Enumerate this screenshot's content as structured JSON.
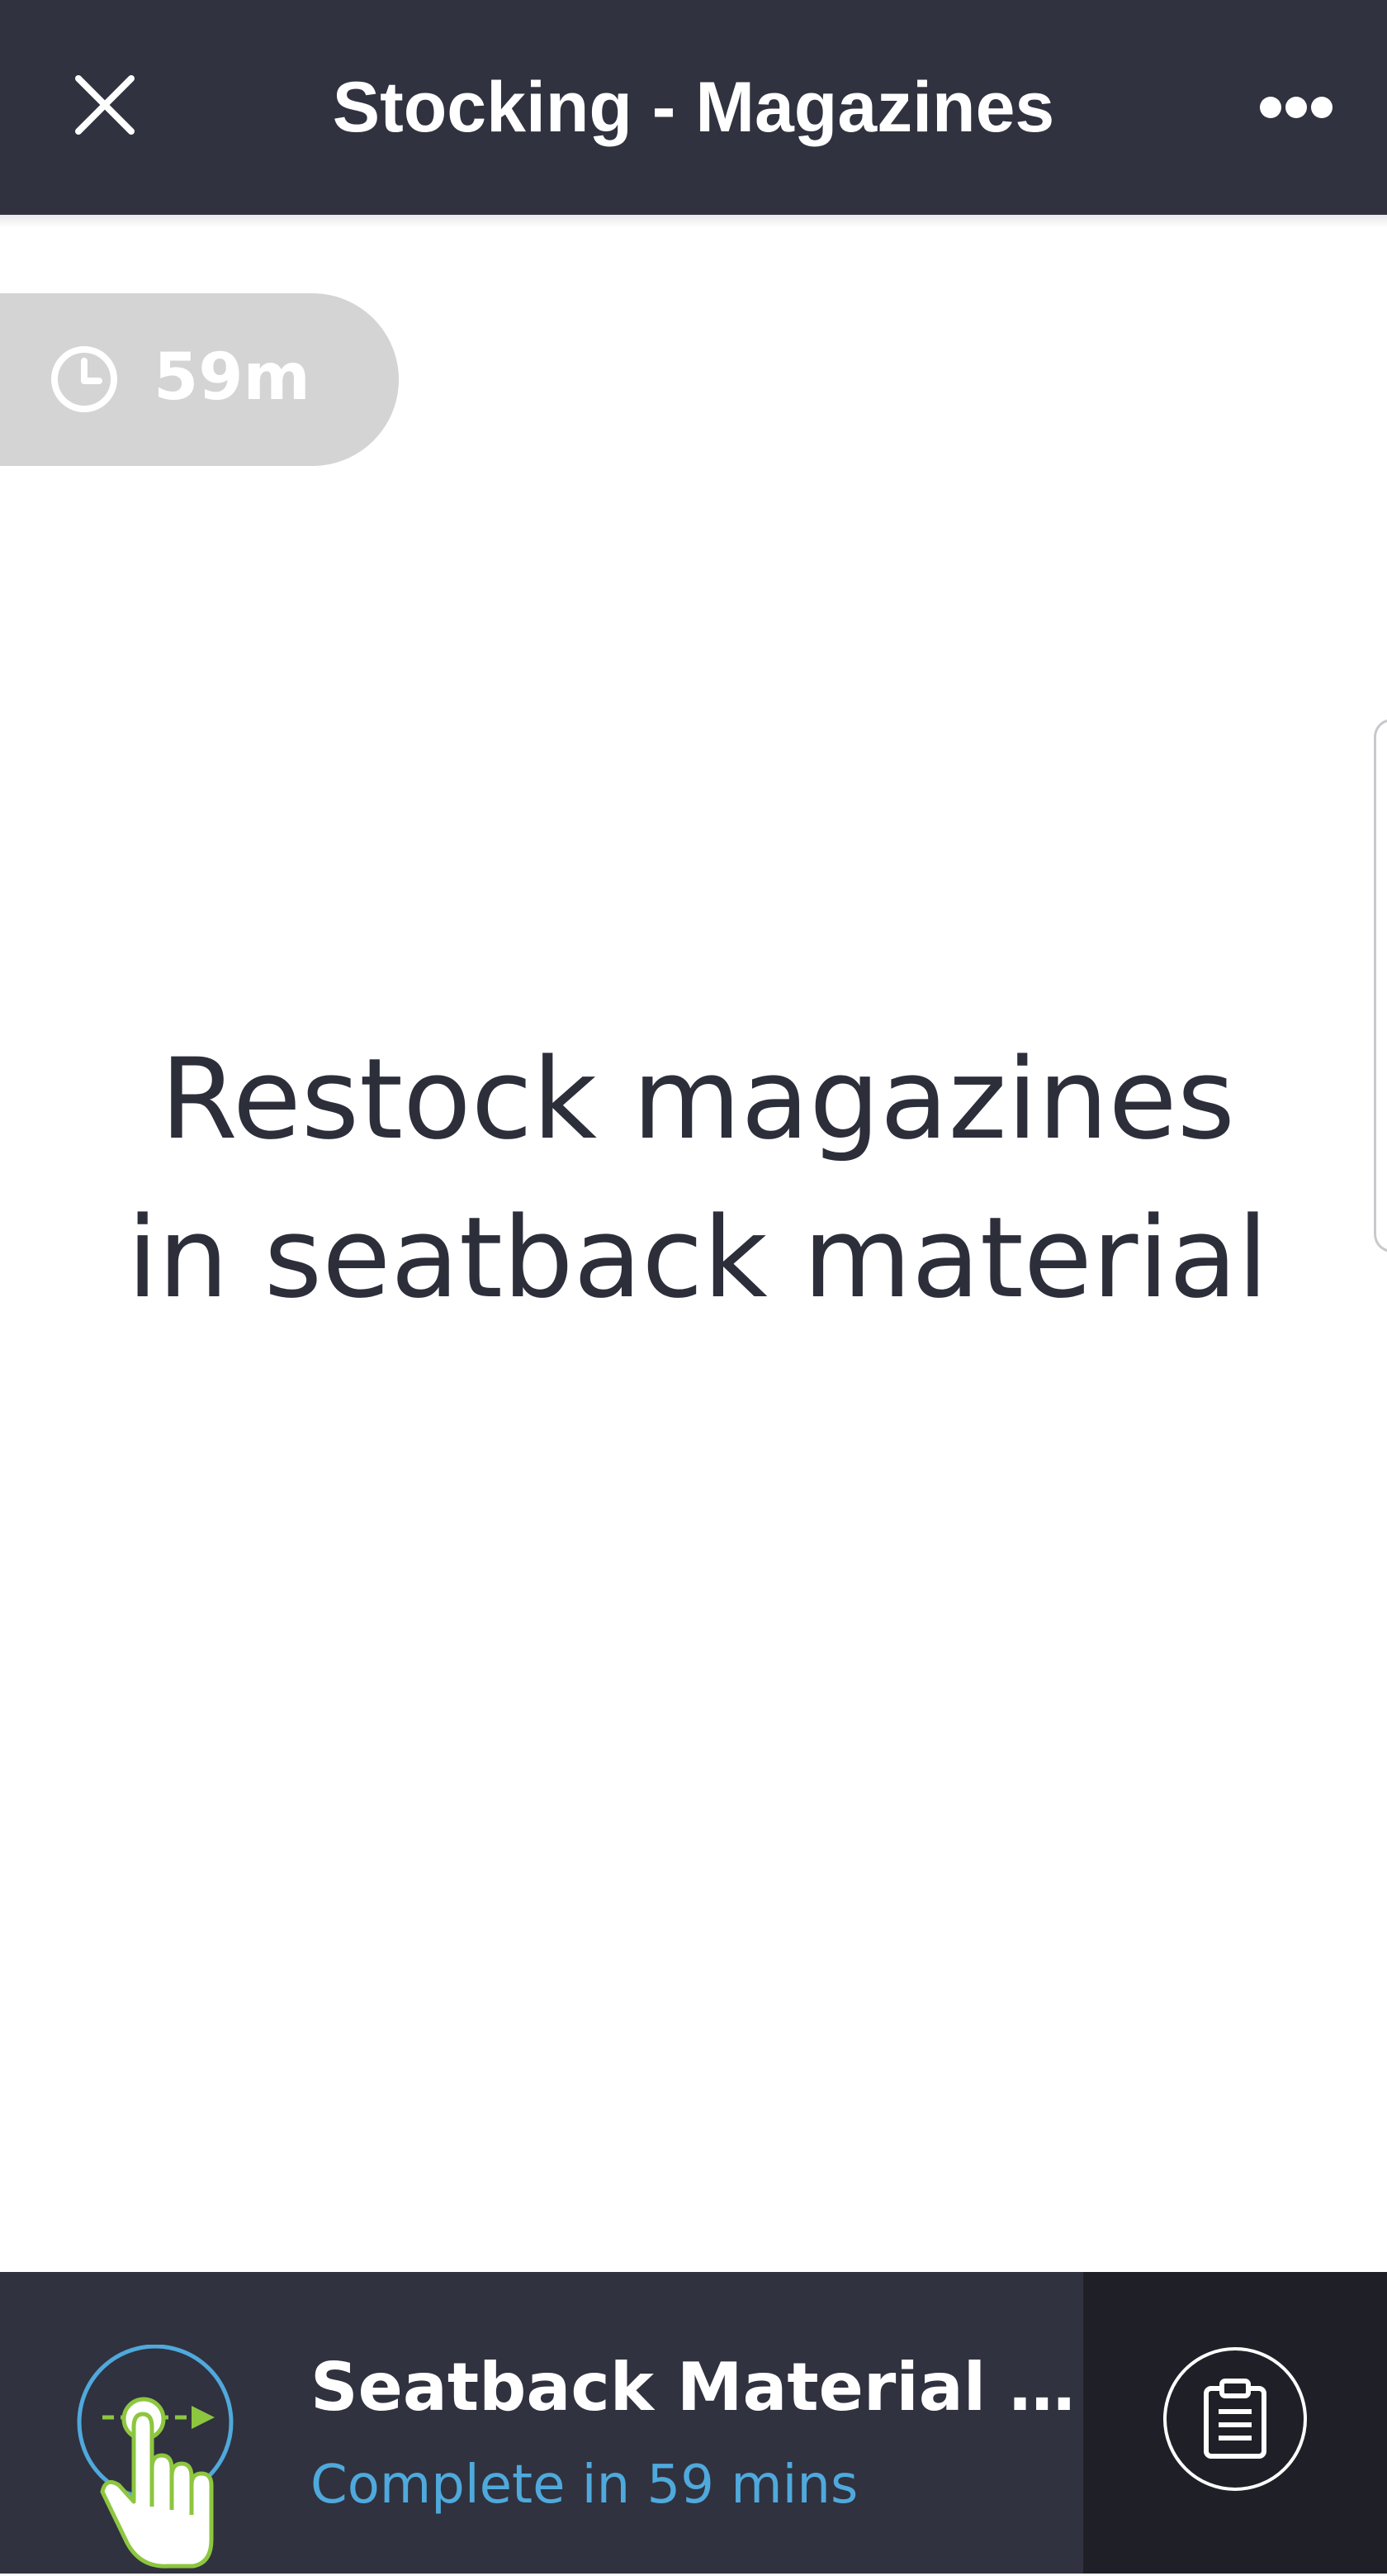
{
  "header": {
    "title": "Stocking - Magazines",
    "close_icon": "close-icon",
    "more_icon": "more-horizontal-icon",
    "background": "#30323f"
  },
  "timer": {
    "label": "59m",
    "icon": "clock-icon",
    "background": "#d4d4d4"
  },
  "task": {
    "instruction": "Restock magazines in seatback material"
  },
  "footer": {
    "task_title": "Seatback Material - M...",
    "task_subtitle": "Complete in 59 mins",
    "swipe_icon": "swipe-gesture-icon",
    "clipboard_icon": "clipboard-icon",
    "subtitle_color": "#4fa9dc",
    "background": "#30323f",
    "panel_background": "#1f2027"
  }
}
